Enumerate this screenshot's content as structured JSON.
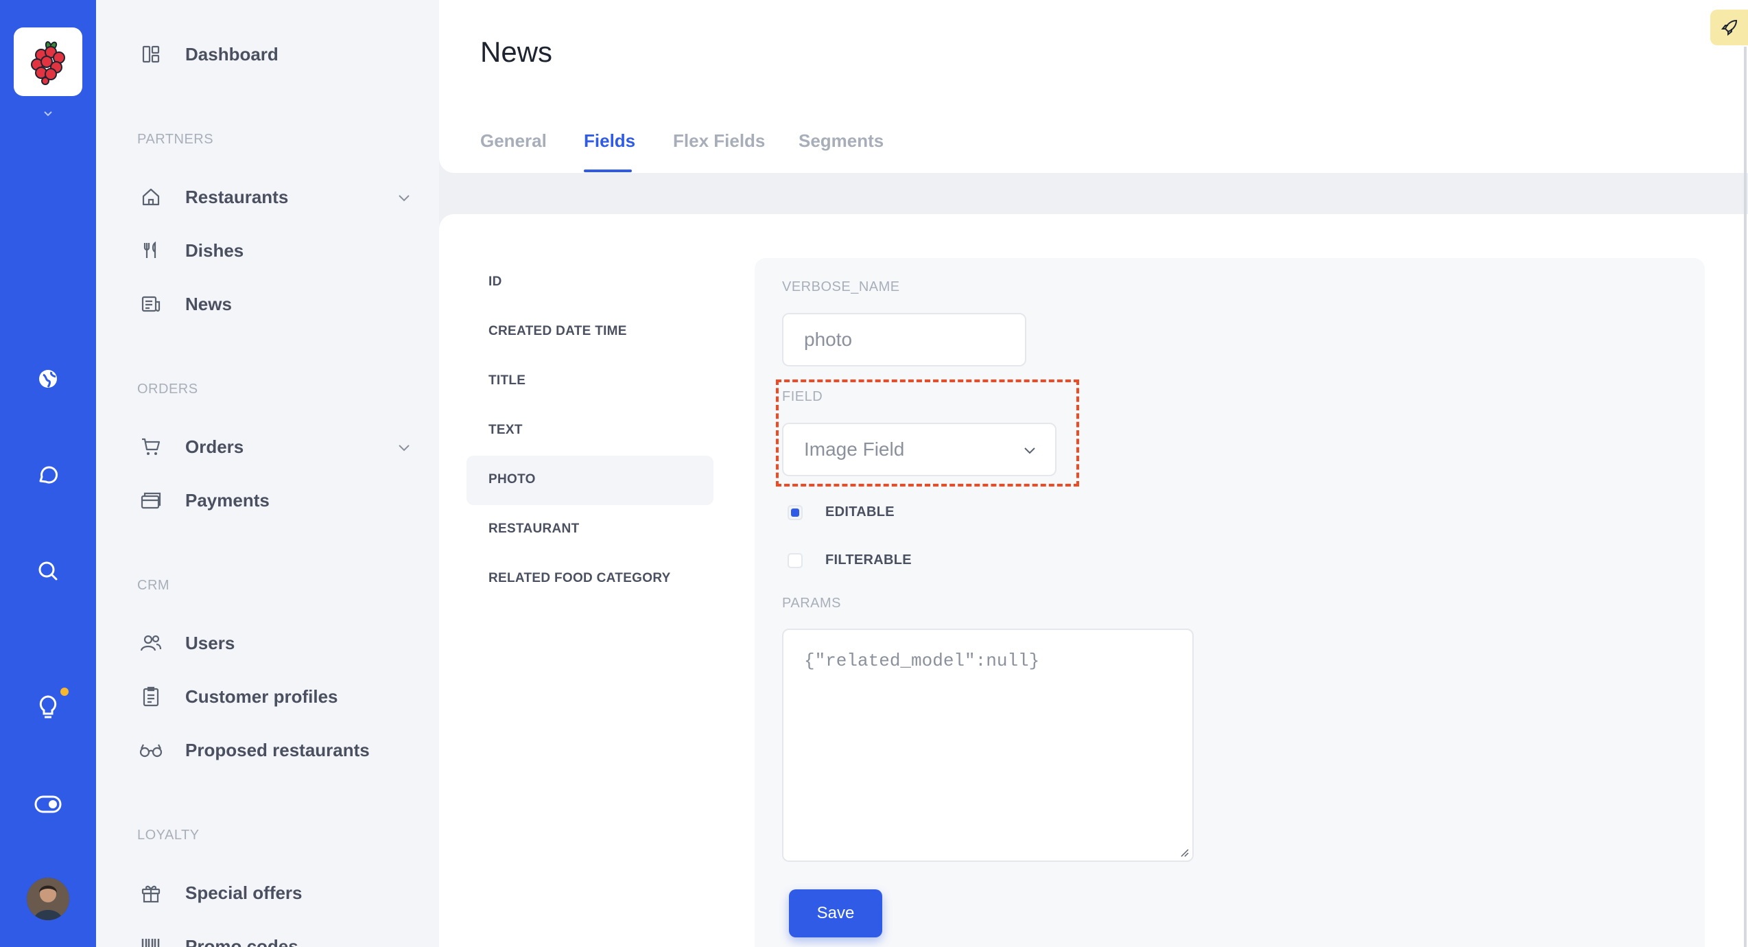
{
  "page": {
    "title": "News"
  },
  "tabs": [
    {
      "label": "General"
    },
    {
      "label": "Fields"
    },
    {
      "label": "Flex Fields"
    },
    {
      "label": "Segments"
    }
  ],
  "sidebar": {
    "dashboard": "Dashboard",
    "sections": {
      "partners": "PARTNERS",
      "orders": "ORDERS",
      "crm": "CRM",
      "loyalty": "LOYALTY"
    },
    "items": {
      "restaurants": "Restaurants",
      "dishes": "Dishes",
      "news": "News",
      "orders": "Orders",
      "payments": "Payments",
      "users": "Users",
      "customer_profiles": "Customer profiles",
      "proposed_restaurants": "Proposed restaurants",
      "special_offers": "Special offers",
      "promo_codes": "Promo codes"
    }
  },
  "fields_list": [
    "ID",
    "CREATED DATE TIME",
    "TITLE",
    "TEXT",
    "PHOTO",
    "RESTAURANT",
    "RELATED FOOD CATEGORY"
  ],
  "form": {
    "verbose_name_label": "VERBOSE_NAME",
    "verbose_name_value": "photo",
    "field_label": "FIELD",
    "field_value": "Image Field",
    "editable_label": "EDITABLE",
    "editable_checked": true,
    "filterable_label": "FILTERABLE",
    "filterable_checked": false,
    "params_label": "PARAMS",
    "params_value": "{\"related_model\":null}",
    "save_label": "Save"
  },
  "colors": {
    "accent": "#2f5be7",
    "highlight": "#f04a24",
    "notification": "#f5b82e"
  },
  "icons": [
    "raspberry-logo",
    "chevron-down-icon",
    "globe-icon",
    "chat-icon",
    "search-icon",
    "lightbulb-icon",
    "toggle-icon",
    "rocket-icon"
  ]
}
